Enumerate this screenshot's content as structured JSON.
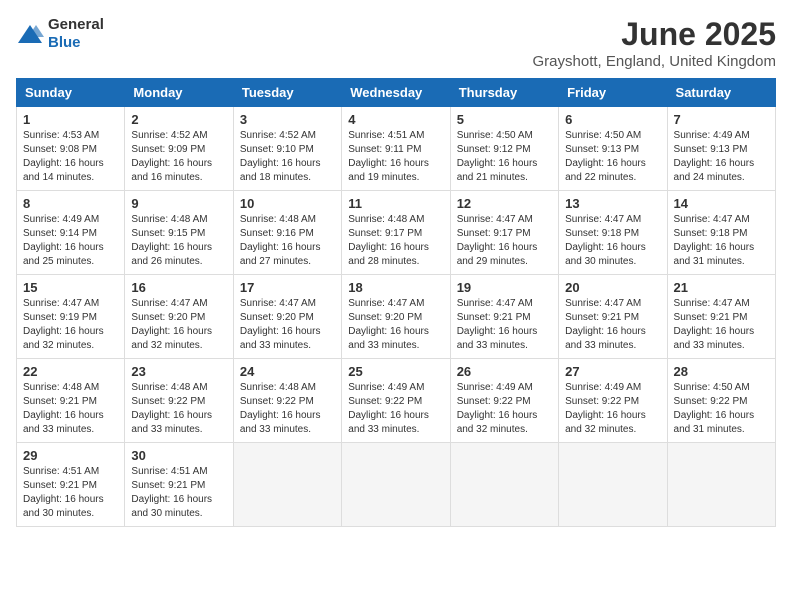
{
  "logo": {
    "general": "General",
    "blue": "Blue"
  },
  "header": {
    "month_year": "June 2025",
    "location": "Grayshott, England, United Kingdom"
  },
  "days_of_week": [
    "Sunday",
    "Monday",
    "Tuesday",
    "Wednesday",
    "Thursday",
    "Friday",
    "Saturday"
  ],
  "weeks": [
    [
      {
        "day": "1",
        "sunrise": "4:53 AM",
        "sunset": "9:08 PM",
        "daylight": "16 hours and 14 minutes."
      },
      {
        "day": "2",
        "sunrise": "4:52 AM",
        "sunset": "9:09 PM",
        "daylight": "16 hours and 16 minutes."
      },
      {
        "day": "3",
        "sunrise": "4:52 AM",
        "sunset": "9:10 PM",
        "daylight": "16 hours and 18 minutes."
      },
      {
        "day": "4",
        "sunrise": "4:51 AM",
        "sunset": "9:11 PM",
        "daylight": "16 hours and 19 minutes."
      },
      {
        "day": "5",
        "sunrise": "4:50 AM",
        "sunset": "9:12 PM",
        "daylight": "16 hours and 21 minutes."
      },
      {
        "day": "6",
        "sunrise": "4:50 AM",
        "sunset": "9:13 PM",
        "daylight": "16 hours and 22 minutes."
      },
      {
        "day": "7",
        "sunrise": "4:49 AM",
        "sunset": "9:13 PM",
        "daylight": "16 hours and 24 minutes."
      }
    ],
    [
      {
        "day": "8",
        "sunrise": "4:49 AM",
        "sunset": "9:14 PM",
        "daylight": "16 hours and 25 minutes."
      },
      {
        "day": "9",
        "sunrise": "4:48 AM",
        "sunset": "9:15 PM",
        "daylight": "16 hours and 26 minutes."
      },
      {
        "day": "10",
        "sunrise": "4:48 AM",
        "sunset": "9:16 PM",
        "daylight": "16 hours and 27 minutes."
      },
      {
        "day": "11",
        "sunrise": "4:48 AM",
        "sunset": "9:17 PM",
        "daylight": "16 hours and 28 minutes."
      },
      {
        "day": "12",
        "sunrise": "4:47 AM",
        "sunset": "9:17 PM",
        "daylight": "16 hours and 29 minutes."
      },
      {
        "day": "13",
        "sunrise": "4:47 AM",
        "sunset": "9:18 PM",
        "daylight": "16 hours and 30 minutes."
      },
      {
        "day": "14",
        "sunrise": "4:47 AM",
        "sunset": "9:18 PM",
        "daylight": "16 hours and 31 minutes."
      }
    ],
    [
      {
        "day": "15",
        "sunrise": "4:47 AM",
        "sunset": "9:19 PM",
        "daylight": "16 hours and 32 minutes."
      },
      {
        "day": "16",
        "sunrise": "4:47 AM",
        "sunset": "9:20 PM",
        "daylight": "16 hours and 32 minutes."
      },
      {
        "day": "17",
        "sunrise": "4:47 AM",
        "sunset": "9:20 PM",
        "daylight": "16 hours and 33 minutes."
      },
      {
        "day": "18",
        "sunrise": "4:47 AM",
        "sunset": "9:20 PM",
        "daylight": "16 hours and 33 minutes."
      },
      {
        "day": "19",
        "sunrise": "4:47 AM",
        "sunset": "9:21 PM",
        "daylight": "16 hours and 33 minutes."
      },
      {
        "day": "20",
        "sunrise": "4:47 AM",
        "sunset": "9:21 PM",
        "daylight": "16 hours and 33 minutes."
      },
      {
        "day": "21",
        "sunrise": "4:47 AM",
        "sunset": "9:21 PM",
        "daylight": "16 hours and 33 minutes."
      }
    ],
    [
      {
        "day": "22",
        "sunrise": "4:48 AM",
        "sunset": "9:21 PM",
        "daylight": "16 hours and 33 minutes."
      },
      {
        "day": "23",
        "sunrise": "4:48 AM",
        "sunset": "9:22 PM",
        "daylight": "16 hours and 33 minutes."
      },
      {
        "day": "24",
        "sunrise": "4:48 AM",
        "sunset": "9:22 PM",
        "daylight": "16 hours and 33 minutes."
      },
      {
        "day": "25",
        "sunrise": "4:49 AM",
        "sunset": "9:22 PM",
        "daylight": "16 hours and 33 minutes."
      },
      {
        "day": "26",
        "sunrise": "4:49 AM",
        "sunset": "9:22 PM",
        "daylight": "16 hours and 32 minutes."
      },
      {
        "day": "27",
        "sunrise": "4:49 AM",
        "sunset": "9:22 PM",
        "daylight": "16 hours and 32 minutes."
      },
      {
        "day": "28",
        "sunrise": "4:50 AM",
        "sunset": "9:22 PM",
        "daylight": "16 hours and 31 minutes."
      }
    ],
    [
      {
        "day": "29",
        "sunrise": "4:51 AM",
        "sunset": "9:21 PM",
        "daylight": "16 hours and 30 minutes."
      },
      {
        "day": "30",
        "sunrise": "4:51 AM",
        "sunset": "9:21 PM",
        "daylight": "16 hours and 30 minutes."
      },
      null,
      null,
      null,
      null,
      null
    ]
  ],
  "labels": {
    "sunrise": "Sunrise:",
    "sunset": "Sunset:",
    "daylight": "Daylight:"
  }
}
